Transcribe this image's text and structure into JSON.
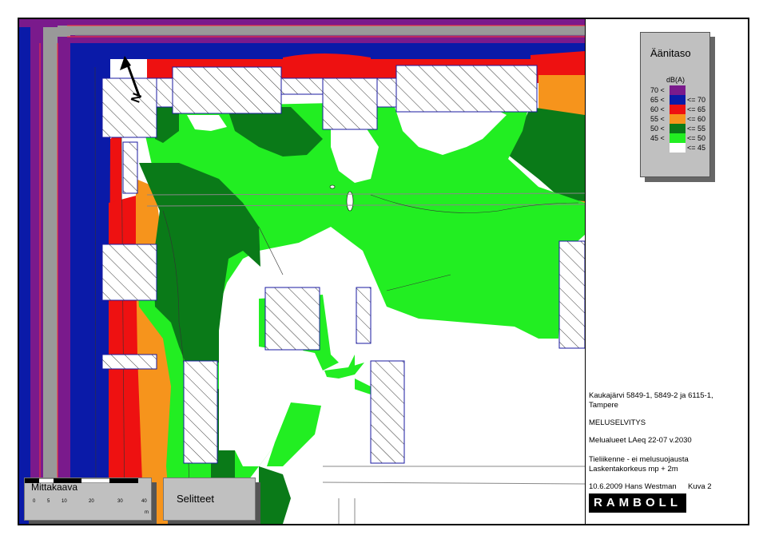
{
  "legend": {
    "title": "Äänitaso",
    "unit": "dB(A)",
    "rows": [
      {
        "lo": "70 <",
        "hi": "",
        "color": "#7a1a8c"
      },
      {
        "lo": "65 <",
        "hi": "<= 70",
        "color": "#0a1aa8"
      },
      {
        "lo": "60 <",
        "hi": "<= 65",
        "color": "#ee1111"
      },
      {
        "lo": "55 <",
        "hi": "<= 60",
        "color": "#f6941c"
      },
      {
        "lo": "50 <",
        "hi": "<= 55",
        "color": "#0a7a18"
      },
      {
        "lo": "45 <",
        "hi": "<= 50",
        "color": "#22ee22"
      },
      {
        "lo": "",
        "hi": "<= 45",
        "color": "#ffffff"
      }
    ]
  },
  "info": {
    "project_line1": "Kaukajärvi 5849-1, 5849-2 ja 6115-1,",
    "project_line2": "Tampere",
    "report": "MELUSELVITYS",
    "map_title": "Melualueet LAeq 22-07 v.2030",
    "desc_line1": "Tieliikenne - ei melusuojausta",
    "desc_line2": "Laskentakorkeus mp + 2m",
    "date_author": "10.6.2009  Hans Westman",
    "figure": "Kuva 2",
    "logo": "RAMBOLL"
  },
  "scale": {
    "title": "Mittakaava",
    "ticks": [
      "0",
      "5",
      "10",
      "20",
      "30",
      "40"
    ],
    "unit": "m"
  },
  "selitteet": "Selitteet",
  "north_label": "N"
}
